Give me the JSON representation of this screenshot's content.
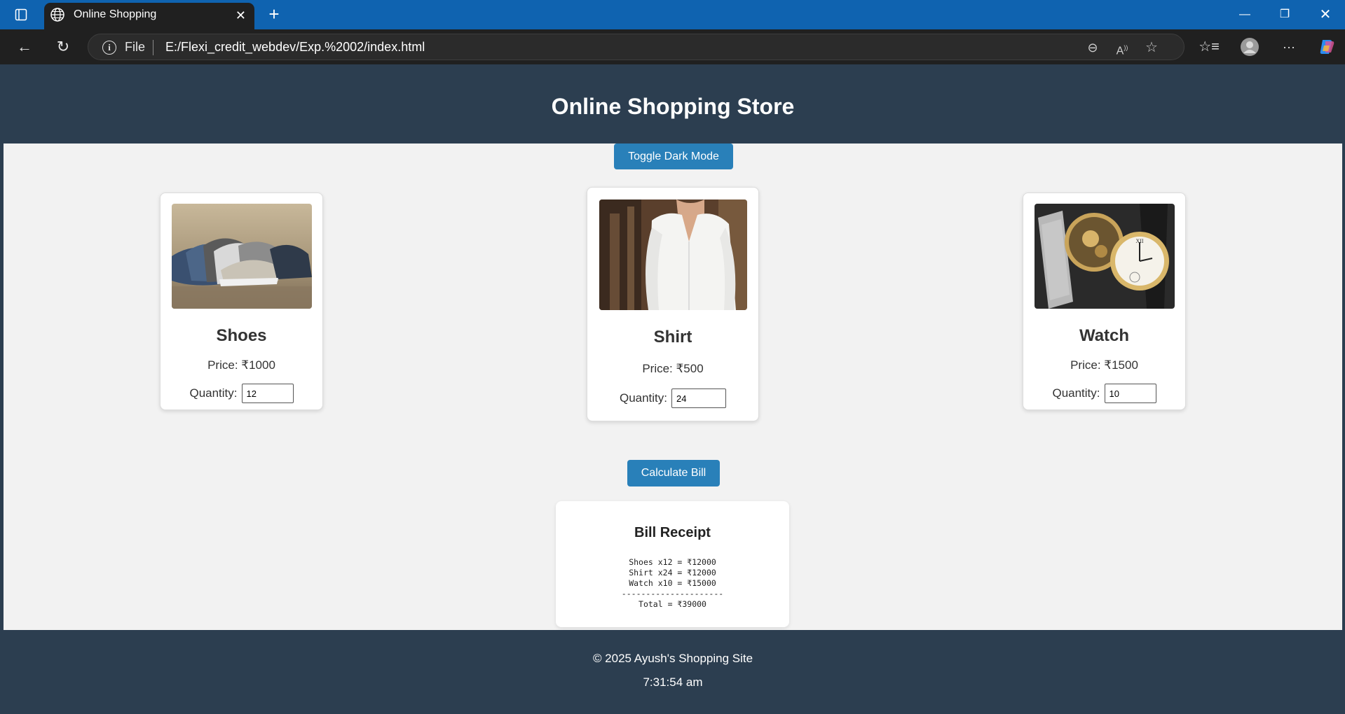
{
  "browser": {
    "tab_title": "Online Shopping",
    "address_scheme": "File",
    "url": "E:/Flexi_credit_webdev/Exp.%2002/index.html"
  },
  "header": {
    "title": "Online Shopping Store"
  },
  "toggle_button_label": "Toggle Dark Mode",
  "products": [
    {
      "name": "Shoes",
      "price_text": "Price: ₹1000",
      "quantity_label": "Quantity:",
      "quantity": "12"
    },
    {
      "name": "Shirt",
      "price_text": "Price: ₹500",
      "quantity_label": "Quantity:",
      "quantity": "24"
    },
    {
      "name": "Watch",
      "price_text": "Price: ₹1500",
      "quantity_label": "Quantity:",
      "quantity": "10"
    }
  ],
  "calculate_button_label": "Calculate Bill",
  "receipt": {
    "title": "Bill Receipt",
    "text": "Shoes x12 = ₹12000\nShirt x24 = ₹12000\nWatch x10 = ₹15000\n---------------------\nTotal = ₹39000"
  },
  "footer": {
    "copyright": "© 2025 Ayush's Shopping Site",
    "clock": "7:31:54 am"
  },
  "colors": {
    "header_bg": "#2c3e50",
    "button_bg": "#2980b9",
    "page_bg": "#f2f2f2",
    "tabbar_bg": "#0f63b0"
  },
  "icons": [
    "sidebar-icon",
    "globe-icon",
    "close-icon",
    "plus-icon",
    "minimize-icon",
    "restore-icon",
    "back-icon",
    "refresh-icon",
    "info-icon",
    "zoom-out-icon",
    "read-aloud-icon",
    "star-icon",
    "favorites-icon",
    "profile-icon",
    "more-icon",
    "copilot-icon"
  ]
}
